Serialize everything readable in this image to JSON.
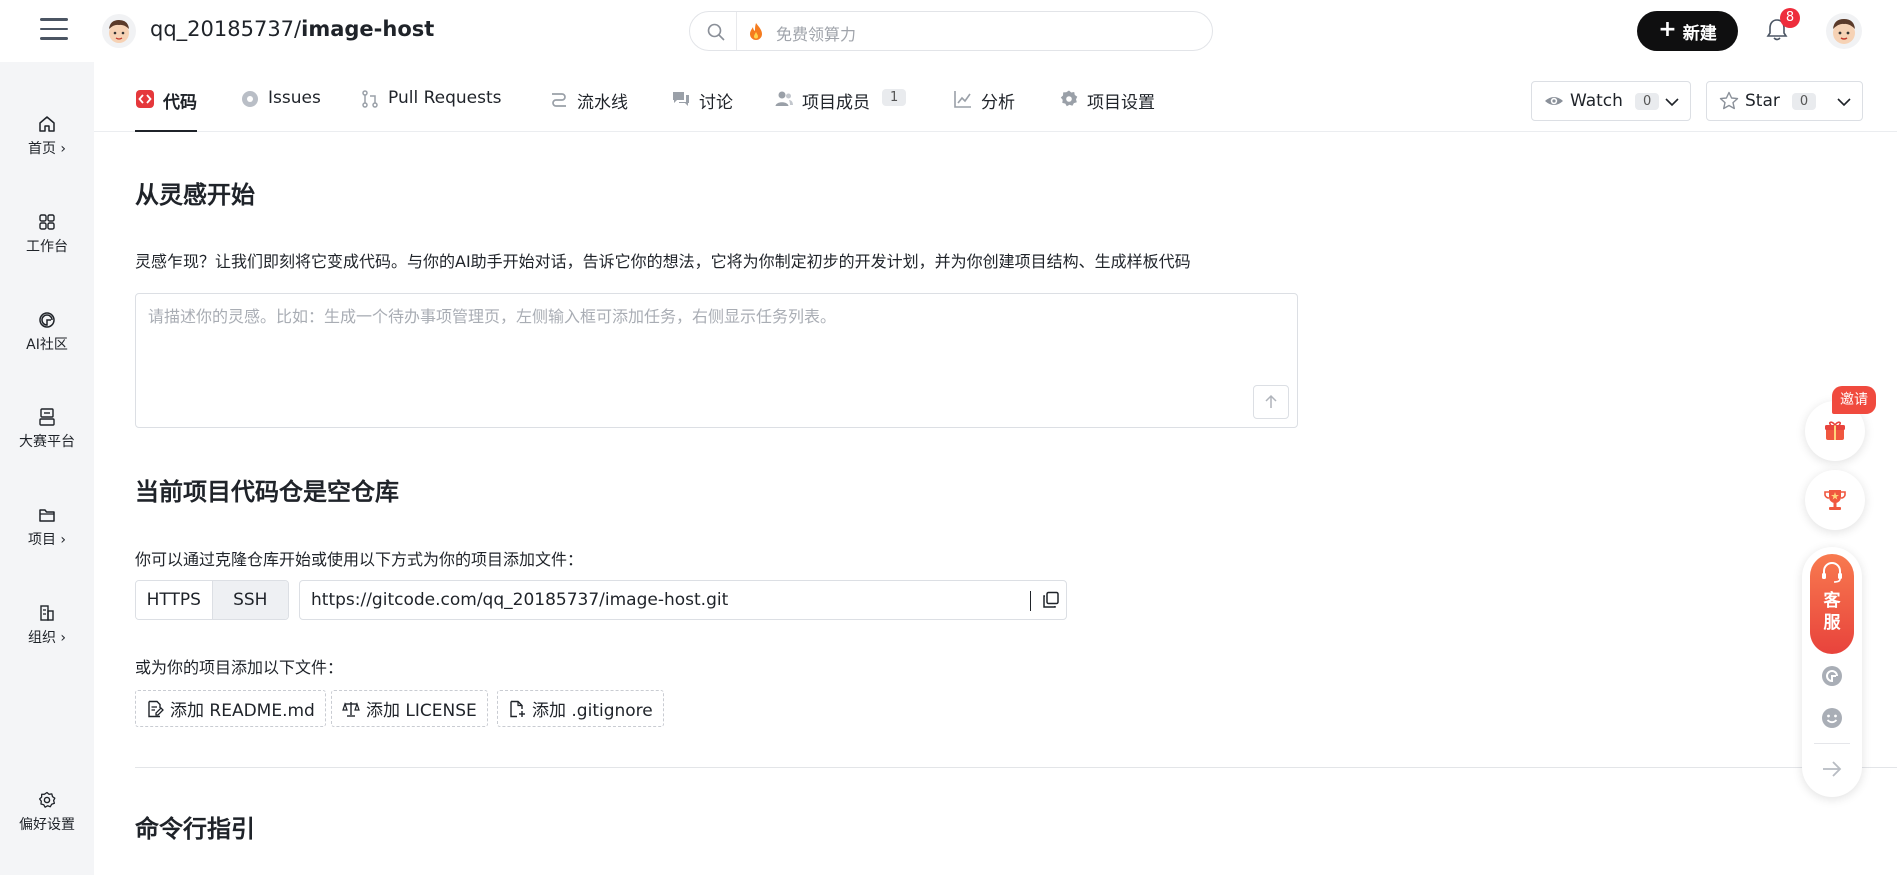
{
  "header": {
    "repo_owner": "qq_20185737/",
    "repo_name": "image-host",
    "search_placeholder": "免费领算力",
    "new_label": "新建",
    "notification_count": "8"
  },
  "sidebar": {
    "items": [
      {
        "label": "首页 ›",
        "icon": "home-icon"
      },
      {
        "label": "工作台",
        "icon": "grid-icon"
      },
      {
        "label": "AI社区",
        "icon": "ai-icon"
      },
      {
        "label": "大赛平台",
        "icon": "contest-icon"
      },
      {
        "label": "项目 ›",
        "icon": "folder-icon"
      },
      {
        "label": "组织 ›",
        "icon": "building-icon"
      },
      {
        "label": "偏好设置",
        "icon": "gear-icon"
      }
    ]
  },
  "tabs": [
    {
      "label": "代码",
      "icon": "code-icon",
      "active": true
    },
    {
      "label": "Issues",
      "icon": "issue-icon"
    },
    {
      "label": "Pull Requests",
      "icon": "pr-icon"
    },
    {
      "label": "流水线",
      "icon": "pipeline-icon"
    },
    {
      "label": "讨论",
      "icon": "discussion-icon"
    },
    {
      "label": "项目成员",
      "icon": "members-icon",
      "count": "1"
    },
    {
      "label": "分析",
      "icon": "chart-icon"
    },
    {
      "label": "项目设置",
      "icon": "settings-icon"
    }
  ],
  "watch": {
    "label": "Watch",
    "count": "0"
  },
  "star": {
    "label": "Star",
    "count": "0"
  },
  "inspiration": {
    "title": "从灵感开始",
    "description": "灵感乍现？让我们即刻将它变成代码。与你的AI助手开始对话，告诉它你的想法，它将为你制定初步的开发计划，并为你创建项目结构、生成样板代码",
    "placeholder": "请描述你的灵感。比如：生成一个待办事项管理页，左侧输入框可添加任务，右侧显示任务列表。"
  },
  "empty_repo": {
    "title": "当前项目代码仓是空仓库",
    "clone_text": "你可以通过克隆仓库开始或使用以下方式为你的项目添加文件：",
    "protocol_https": "HTTPS",
    "protocol_ssh": "SSH",
    "clone_url": "https://gitcode.com/qq_20185737/image-host.git",
    "add_files_text": "或为你的项目添加以下文件：",
    "add_readme": "添加 README.md",
    "add_license": "添加 LICENSE",
    "add_gitignore": "添加 .gitignore"
  },
  "cli": {
    "title": "命令行指引"
  },
  "float": {
    "invite": "邀请",
    "kefu_line1": "客",
    "kefu_line2": "服"
  },
  "colors": {
    "accent_dark": "#0f0f10",
    "badge_red": "#ee2d3c",
    "code_icon_red": "#e5383b",
    "kefu_orange": "#f0573f"
  }
}
